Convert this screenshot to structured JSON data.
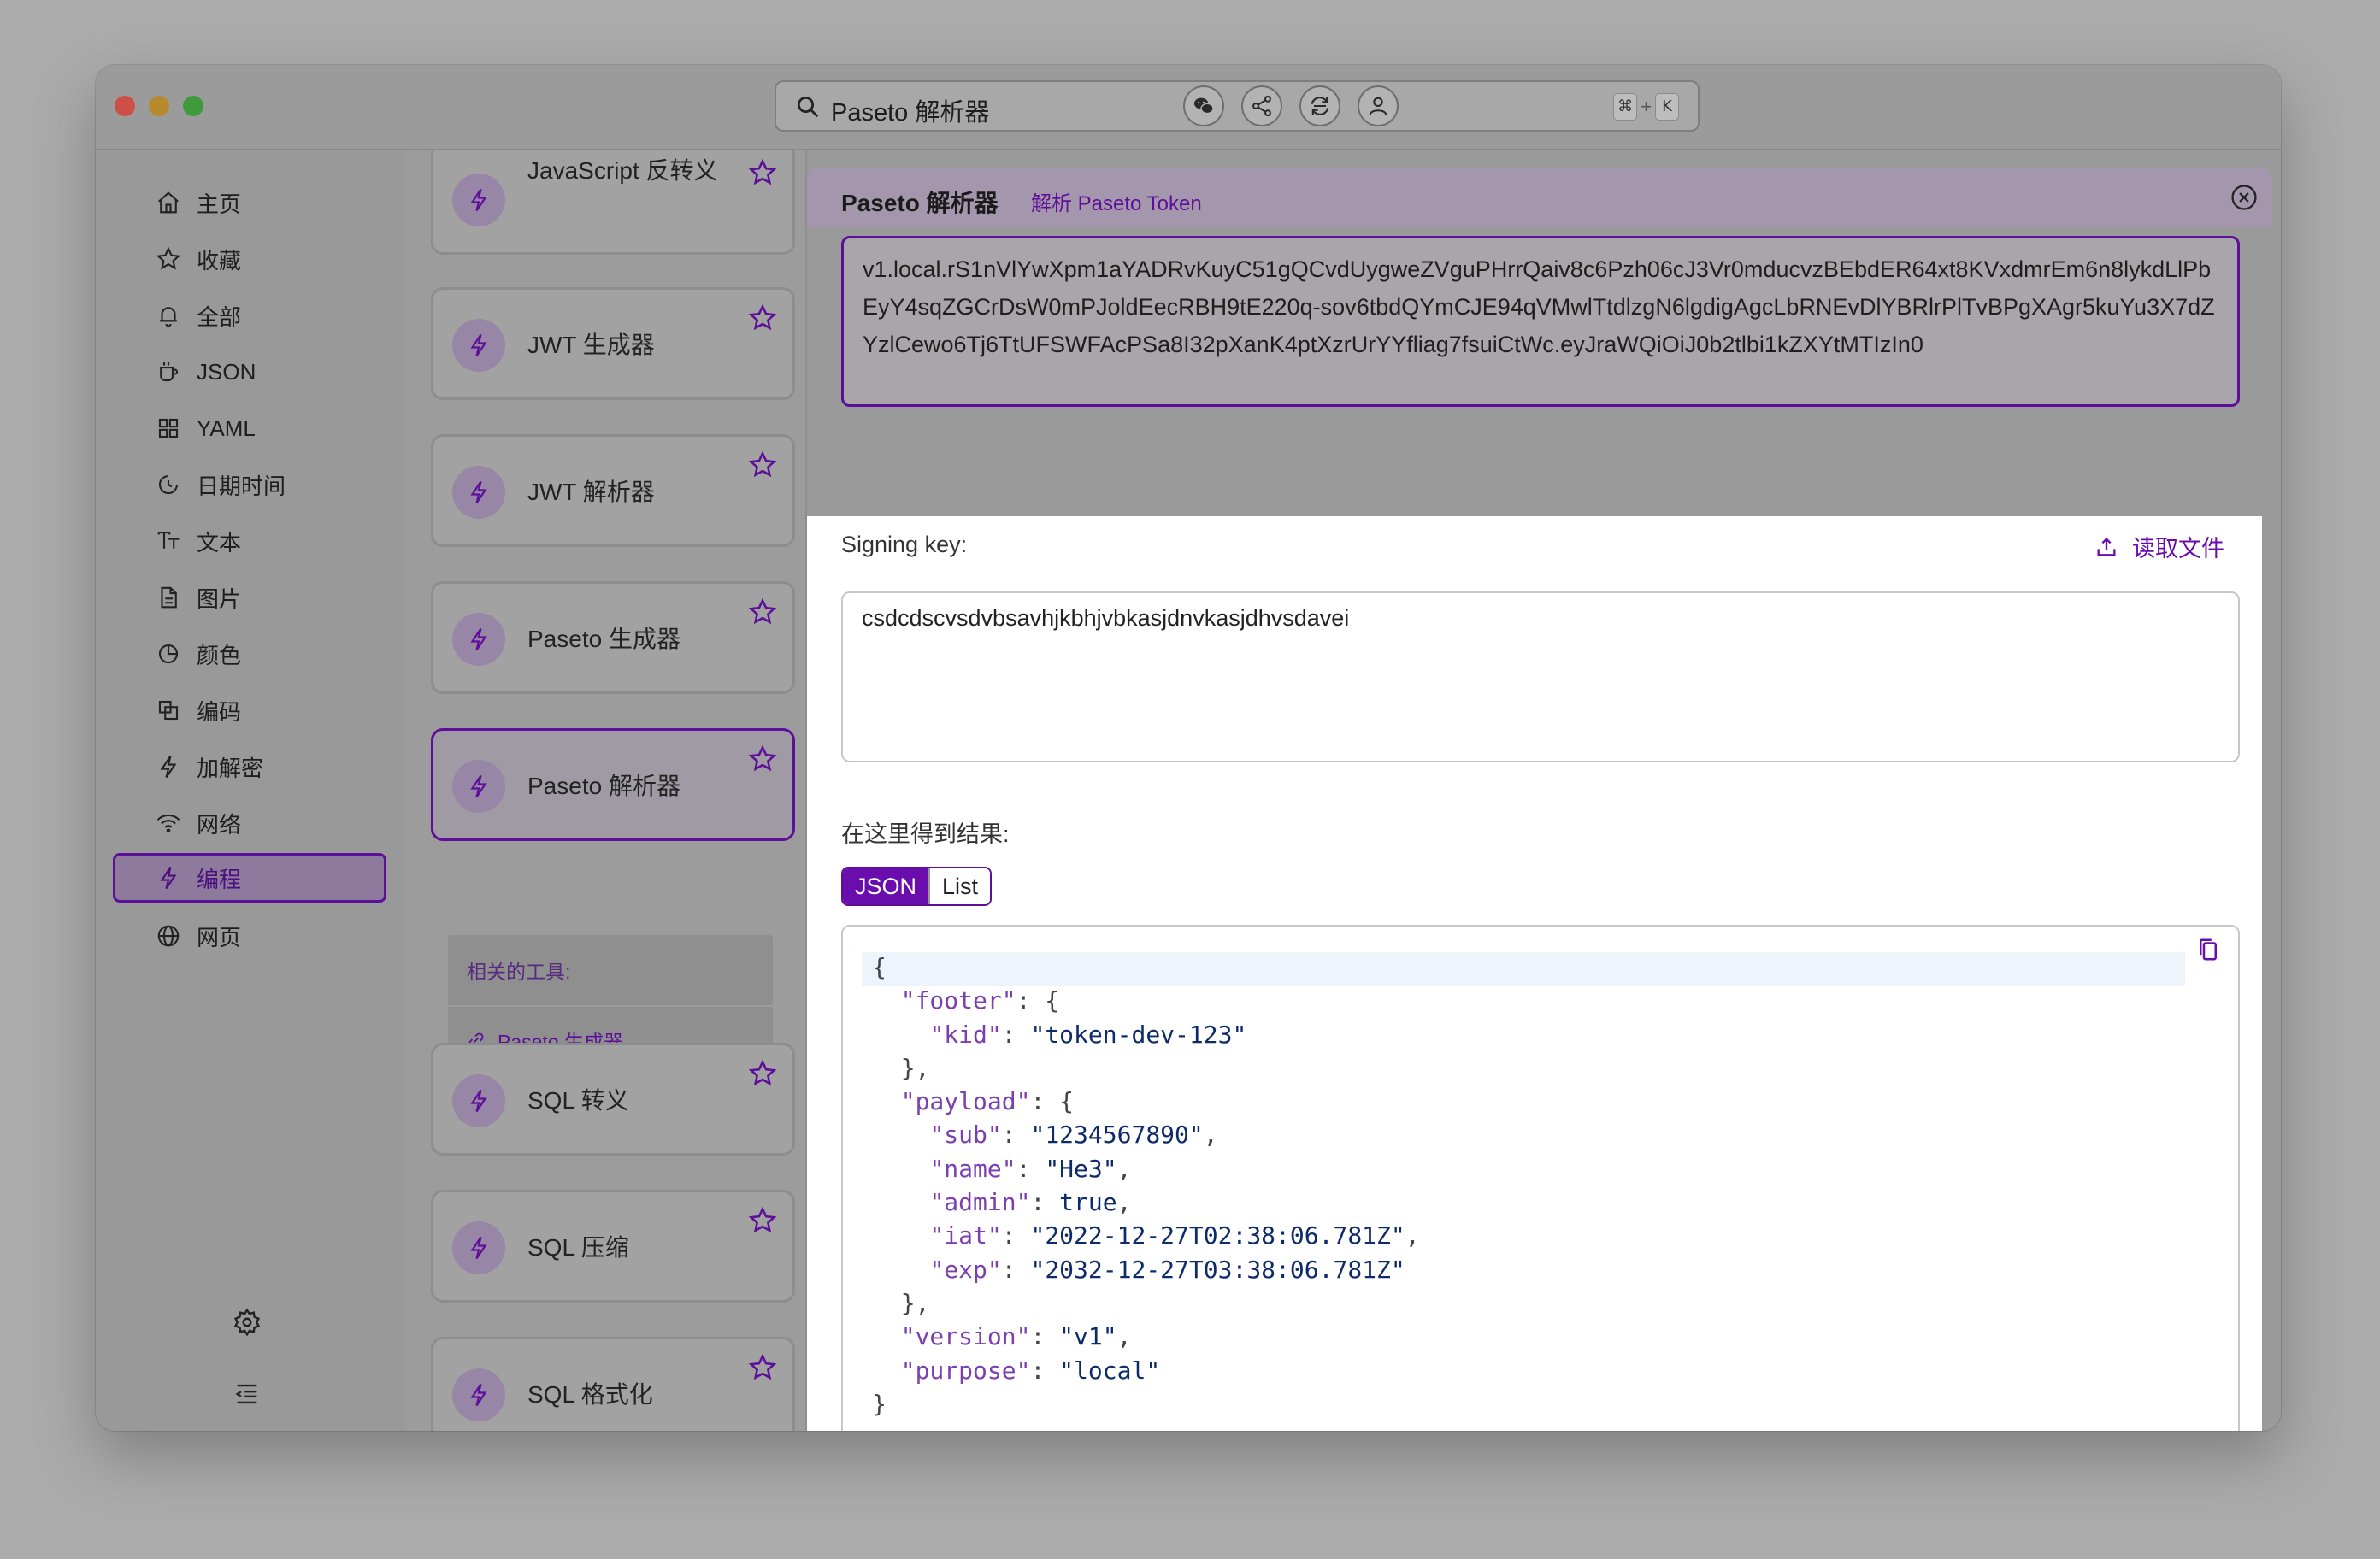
{
  "window": {
    "search": {
      "text": "Paseto 解析器",
      "shortcut_cmd": "⌘",
      "shortcut_plus": "+",
      "shortcut_key": "K"
    },
    "toolbar_icons": [
      "wechat-icon",
      "share-icon",
      "sync-icon",
      "user-icon"
    ]
  },
  "sidebar": {
    "items": [
      {
        "label": "主页",
        "icon": "home-icon"
      },
      {
        "label": "收藏",
        "icon": "star-icon"
      },
      {
        "label": "全部",
        "icon": "bell-icon"
      },
      {
        "label": "JSON",
        "icon": "json-icon"
      },
      {
        "label": "YAML",
        "icon": "grid-icon"
      },
      {
        "label": "日期时间",
        "icon": "clock-icon"
      },
      {
        "label": "文本",
        "icon": "text-icon"
      },
      {
        "label": "图片",
        "icon": "image-file-icon"
      },
      {
        "label": "颜色",
        "icon": "color-icon"
      },
      {
        "label": "编码",
        "icon": "encode-icon"
      },
      {
        "label": "加解密",
        "icon": "bolt-icon"
      },
      {
        "label": "网络",
        "icon": "wifi-icon"
      },
      {
        "label": "编程",
        "icon": "bolt-icon",
        "active": true
      },
      {
        "label": "网页",
        "icon": "globe-icon"
      }
    ],
    "bottom_icons": [
      "settings-icon",
      "collapse-icon"
    ]
  },
  "tools": {
    "cards": [
      {
        "label": "JavaScript 反转义"
      },
      {
        "label": "JWT 生成器"
      },
      {
        "label": "JWT 解析器"
      },
      {
        "label": "Paseto 生成器"
      },
      {
        "label": "Paseto 解析器",
        "active": true
      },
      {
        "label": "SQL 转义"
      },
      {
        "label": "SQL 压缩"
      },
      {
        "label": "SQL 格式化"
      }
    ],
    "related": {
      "title": "相关的工具:",
      "item": "Paseto 生成器"
    }
  },
  "main": {
    "title": "Paseto 解析器",
    "subtitle": "解析 Paseto Token",
    "token": "v1.local.rS1nVlYwXpm1aYADRvKuyC51gQCvdUygweZVguPHrrQaiv8c6Pzh06cJ3Vr0mducvzBEbdER64xt8KVxdmrEm6n8lykdLlPbEyY4sqZGCrDsW0mPJoldEecRBH9tE220q-sov6tbdQYmCJE94qVMwlTtdlzgN6lgdigAgcLbRNEvDlYBRlrPlTvBPgXAgr5kuYu3X7dZYzlCewo6Tj6TtUFSWFAcPSa8I32pXanK4ptXzrUrYYfliag7fsuiCtWc.eyJraWQiOiJ0b2tlbi1kZXYtMTIzIn0",
    "signing_key_label": "Signing key:",
    "read_file_label": "读取文件",
    "signing_key_value": "csdcdscvsdvbsavhjkbhjvbkasjdnvkasjdhvsdavei",
    "result_label": "在这里得到结果:",
    "view_tabs": [
      "JSON",
      "List"
    ],
    "result": {
      "footer_kid": "token-dev-123",
      "sub": "1234567890",
      "name": "He3",
      "admin": "true",
      "iat": "2022-12-27T02:38:06.781Z",
      "exp": "2032-12-27T03:38:06.781Z",
      "version": "v1",
      "purpose": "local"
    }
  }
}
